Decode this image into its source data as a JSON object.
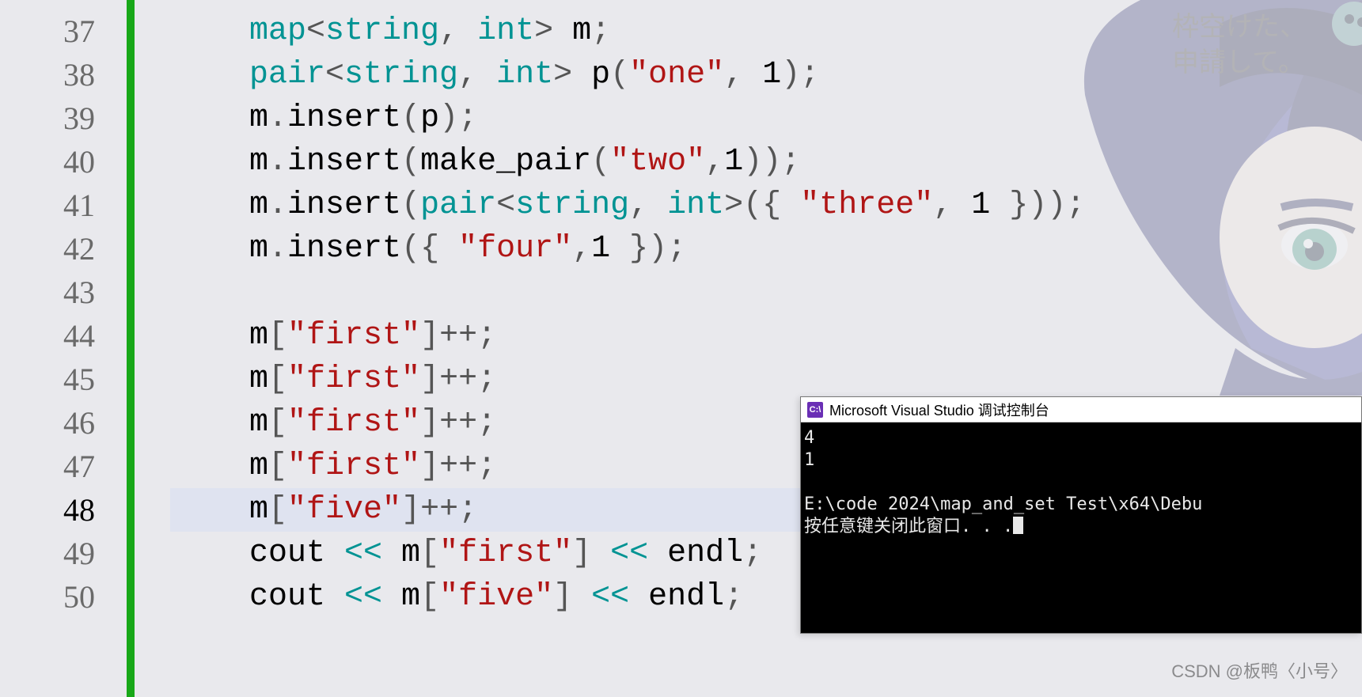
{
  "editor": {
    "line_numbers": [
      37,
      38,
      39,
      40,
      41,
      42,
      43,
      44,
      45,
      46,
      47,
      48,
      49,
      50
    ],
    "current_line_number": 48,
    "code_lines": [
      {
        "n": 37,
        "tokens": [
          {
            "c": "kw",
            "t": "map"
          },
          {
            "c": "punct",
            "t": "<"
          },
          {
            "c": "type",
            "t": "string"
          },
          {
            "c": "punct",
            "t": ", "
          },
          {
            "c": "type",
            "t": "int"
          },
          {
            "c": "punct",
            "t": "> "
          },
          {
            "c": "ident",
            "t": "m"
          },
          {
            "c": "punct",
            "t": ";"
          }
        ]
      },
      {
        "n": 38,
        "tokens": [
          {
            "c": "kw",
            "t": "pair"
          },
          {
            "c": "punct",
            "t": "<"
          },
          {
            "c": "type",
            "t": "string"
          },
          {
            "c": "punct",
            "t": ", "
          },
          {
            "c": "type",
            "t": "int"
          },
          {
            "c": "punct",
            "t": "> "
          },
          {
            "c": "ident",
            "t": "p"
          },
          {
            "c": "punct",
            "t": "("
          },
          {
            "c": "str",
            "t": "\"one\""
          },
          {
            "c": "punct",
            "t": ", "
          },
          {
            "c": "num",
            "t": "1"
          },
          {
            "c": "punct",
            "t": ");"
          }
        ]
      },
      {
        "n": 39,
        "tokens": [
          {
            "c": "ident",
            "t": "m"
          },
          {
            "c": "punct",
            "t": "."
          },
          {
            "c": "ident",
            "t": "insert"
          },
          {
            "c": "punct",
            "t": "("
          },
          {
            "c": "ident",
            "t": "p"
          },
          {
            "c": "punct",
            "t": ");"
          }
        ]
      },
      {
        "n": 40,
        "tokens": [
          {
            "c": "ident",
            "t": "m"
          },
          {
            "c": "punct",
            "t": "."
          },
          {
            "c": "ident",
            "t": "insert"
          },
          {
            "c": "punct",
            "t": "("
          },
          {
            "c": "ident",
            "t": "make_pair"
          },
          {
            "c": "punct",
            "t": "("
          },
          {
            "c": "str",
            "t": "\"two\""
          },
          {
            "c": "punct",
            "t": ","
          },
          {
            "c": "num",
            "t": "1"
          },
          {
            "c": "punct",
            "t": "));"
          }
        ]
      },
      {
        "n": 41,
        "tokens": [
          {
            "c": "ident",
            "t": "m"
          },
          {
            "c": "punct",
            "t": "."
          },
          {
            "c": "ident",
            "t": "insert"
          },
          {
            "c": "punct",
            "t": "("
          },
          {
            "c": "kw",
            "t": "pair"
          },
          {
            "c": "punct",
            "t": "<"
          },
          {
            "c": "type",
            "t": "string"
          },
          {
            "c": "punct",
            "t": ", "
          },
          {
            "c": "type",
            "t": "int"
          },
          {
            "c": "punct",
            "t": ">({ "
          },
          {
            "c": "str",
            "t": "\"three\""
          },
          {
            "c": "punct",
            "t": ", "
          },
          {
            "c": "num",
            "t": "1"
          },
          {
            "c": "punct",
            "t": " }));"
          }
        ]
      },
      {
        "n": 42,
        "tokens": [
          {
            "c": "ident",
            "t": "m"
          },
          {
            "c": "punct",
            "t": "."
          },
          {
            "c": "ident",
            "t": "insert"
          },
          {
            "c": "punct",
            "t": "({ "
          },
          {
            "c": "str",
            "t": "\"four\""
          },
          {
            "c": "punct",
            "t": ","
          },
          {
            "c": "num",
            "t": "1"
          },
          {
            "c": "punct",
            "t": " });"
          }
        ]
      },
      {
        "n": 43,
        "tokens": []
      },
      {
        "n": 44,
        "tokens": [
          {
            "c": "ident",
            "t": "m"
          },
          {
            "c": "punct",
            "t": "["
          },
          {
            "c": "str",
            "t": "\"first\""
          },
          {
            "c": "punct",
            "t": "]++;"
          }
        ]
      },
      {
        "n": 45,
        "tokens": [
          {
            "c": "ident",
            "t": "m"
          },
          {
            "c": "punct",
            "t": "["
          },
          {
            "c": "str",
            "t": "\"first\""
          },
          {
            "c": "punct",
            "t": "]++;"
          }
        ]
      },
      {
        "n": 46,
        "tokens": [
          {
            "c": "ident",
            "t": "m"
          },
          {
            "c": "punct",
            "t": "["
          },
          {
            "c": "str",
            "t": "\"first\""
          },
          {
            "c": "punct",
            "t": "]++;"
          }
        ]
      },
      {
        "n": 47,
        "tokens": [
          {
            "c": "ident",
            "t": "m"
          },
          {
            "c": "punct",
            "t": "["
          },
          {
            "c": "str",
            "t": "\"first\""
          },
          {
            "c": "punct",
            "t": "]++;"
          }
        ]
      },
      {
        "n": 48,
        "tokens": [
          {
            "c": "ident",
            "t": "m"
          },
          {
            "c": "punct",
            "t": "["
          },
          {
            "c": "str",
            "t": "\"five\""
          },
          {
            "c": "punct",
            "t": "]++;"
          }
        ]
      },
      {
        "n": 49,
        "tokens": [
          {
            "c": "ident",
            "t": "cout "
          },
          {
            "c": "op",
            "t": "<<"
          },
          {
            "c": "ident",
            "t": " m"
          },
          {
            "c": "punct",
            "t": "["
          },
          {
            "c": "str",
            "t": "\"first\""
          },
          {
            "c": "punct",
            "t": "] "
          },
          {
            "c": "op",
            "t": "<<"
          },
          {
            "c": "ident",
            "t": " endl"
          },
          {
            "c": "punct",
            "t": ";"
          }
        ]
      },
      {
        "n": 50,
        "tokens": [
          {
            "c": "ident",
            "t": "cout "
          },
          {
            "c": "op",
            "t": "<<"
          },
          {
            "c": "ident",
            "t": " m"
          },
          {
            "c": "punct",
            "t": "["
          },
          {
            "c": "str",
            "t": "\"five\""
          },
          {
            "c": "punct",
            "t": "] "
          },
          {
            "c": "op",
            "t": "<<"
          },
          {
            "c": "ident",
            "t": " endl"
          },
          {
            "c": "punct",
            "t": ";"
          }
        ]
      }
    ]
  },
  "console": {
    "icon_label": "C:\\",
    "title": "Microsoft Visual Studio 调试控制台",
    "output_lines": [
      "4",
      "1",
      "",
      "E:\\code 2024\\map_and_set Test\\x64\\Debu",
      "按任意键关闭此窗口. . ."
    ]
  },
  "art_text": {
    "line1": "枠空けた、",
    "line2": "申請して。"
  },
  "watermark": "CSDN @板鸭〈小号〉"
}
